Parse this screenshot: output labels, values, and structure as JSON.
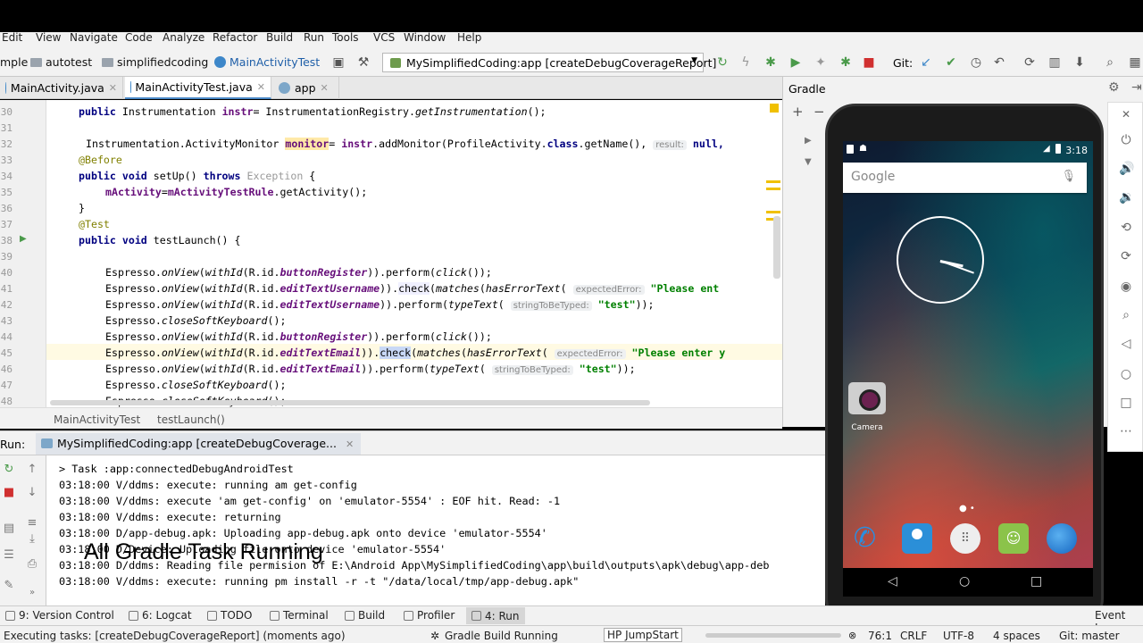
{
  "menubar": {
    "items": [
      "Edit",
      "View",
      "Navigate",
      "Code",
      "Analyze",
      "Refactor",
      "Build",
      "Run",
      "Tools",
      "VCS",
      "Window",
      "Help"
    ]
  },
  "navbar": {
    "crumbs": [
      "mple",
      "autotest",
      "simplifiedcoding",
      "MainActivityTest"
    ],
    "run_config": "MySimplifiedCoding:app [createDebugCoverageReport]",
    "git_label": "Git:"
  },
  "tabs": [
    {
      "label": "MainActivity.java",
      "active": false
    },
    {
      "label": "MainActivityTest.java",
      "active": true
    },
    {
      "label": "app",
      "active": false
    }
  ],
  "editor": {
    "line_numbers": [
      "30",
      "31",
      "32",
      "33",
      "34",
      "35",
      "36",
      "37",
      "38",
      "39",
      "40",
      "41",
      "42",
      "43",
      "44",
      "45",
      "46",
      "47",
      "48"
    ],
    "hints": {
      "result": "result:",
      "expected_error": "expectedError:",
      "string_to_be_typed": "stringToBeTyped:"
    },
    "strings": {
      "please_ent": "\"Please ent",
      "please_enter_y": "\"Please enter y",
      "test": "\"test\"",
      "null": "null,"
    }
  },
  "breadcrumb_bar": {
    "class_name": "MainActivityTest",
    "method_name": "testLaunch()"
  },
  "run_panel": {
    "label": "Run:",
    "tab_label": "MySimplifiedCoding:app [createDebugCoverage...",
    "lines": [
      "> Task :app:connectedDebugAndroidTest",
      "03:18:00 V/ddms: execute: running am get-config",
      "03:18:00 V/ddms: execute 'am get-config' on 'emulator-5554' : EOF hit. Read: -1",
      "03:18:00 V/ddms: execute: returning",
      "03:18:00 D/app-debug.apk: Uploading app-debug.apk onto device 'emulator-5554'",
      "03:18:00 D/Device: Uploading file onto device 'emulator-5554'",
      "03:18:00 D/ddms: Reading file permision of E:\\Android App\\MySimplifiedCoding\\app\\build\\outputs\\apk\\debug\\app-deb",
      "03:18:00 V/ddms: execute: running pm install -r -t \"/data/local/tmp/app-debug.apk\""
    ]
  },
  "overlay_caption": "All Gradle Task Running",
  "tool_windows": [
    {
      "label": "9: Version Control"
    },
    {
      "label": "6: Logcat"
    },
    {
      "label": "TODO"
    },
    {
      "label": "Terminal"
    },
    {
      "label": "Build"
    },
    {
      "label": "Profiler"
    },
    {
      "label": "4: Run"
    }
  ],
  "event_log": "Event Log",
  "status": {
    "left": "Executing tasks: [createDebugCoverageReport] (moments ago)",
    "center": "Gradle Build Running",
    "hp": "HP JumpStart",
    "position": "76:1",
    "line_sep": "CRLF",
    "encoding": "UTF-8",
    "indent": "4 spaces",
    "git_branch": "Git: master"
  },
  "gradle_panel": {
    "title": "Gradle"
  },
  "emulator": {
    "time": "3:18",
    "search_brand": "Google",
    "camera_label": "Camera"
  },
  "colors": {
    "accent": "#4a88c7",
    "keyword": "#000080",
    "field": "#660e7a",
    "string": "#008000"
  }
}
